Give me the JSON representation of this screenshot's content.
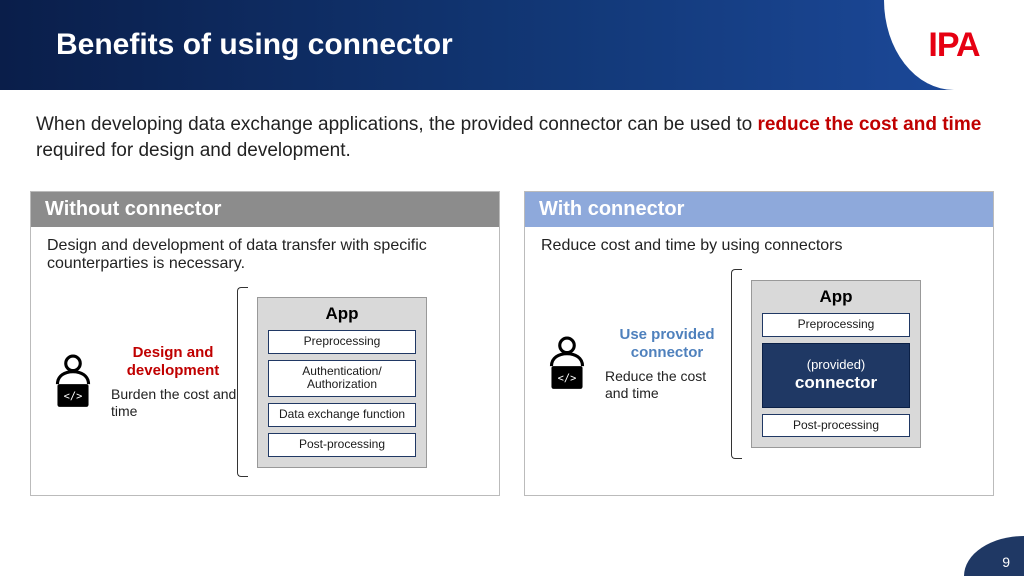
{
  "header": {
    "title": "Benefits of using connector",
    "logo": "IPA"
  },
  "intro": {
    "pre": "When developing data exchange applications, the provided connector can be used to ",
    "emph": "reduce the cost and time",
    "post": " required for design and development."
  },
  "panel_a": {
    "title": "Without connector",
    "desc": "Design and development of data transfer with specific counterparties is necessary.",
    "label": "Design and development",
    "sub": "Burden the cost and time",
    "app_title": "App",
    "modules": [
      "Preprocessing",
      "Authentication/\nAuthorization",
      "Data exchange\nfunction",
      "Post-processing"
    ]
  },
  "panel_b": {
    "title": "With connector",
    "desc": "Reduce cost and time by using connectors",
    "label": "Use provided connector",
    "sub": "Reduce the cost and time",
    "app_title": "App",
    "module_pre": "Preprocessing",
    "provided_1": "(provided)",
    "provided_2": "connector",
    "module_post": "Post-processing"
  },
  "page": "9"
}
